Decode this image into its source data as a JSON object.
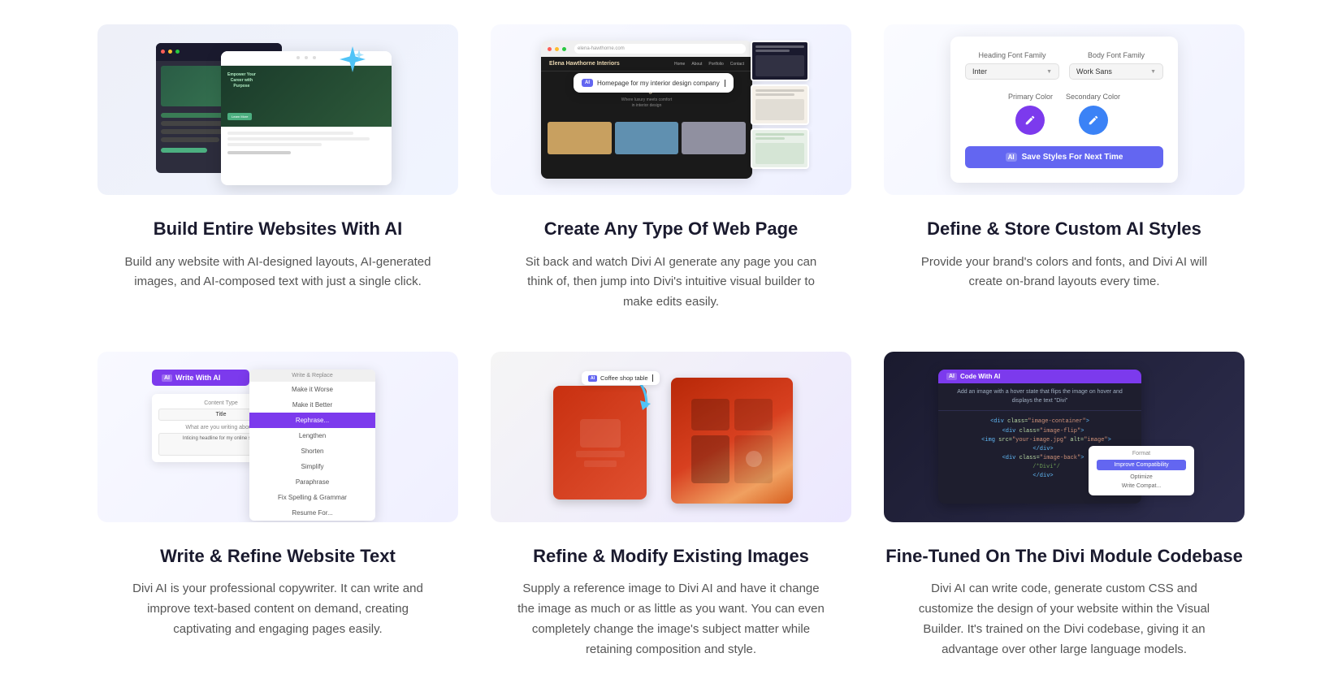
{
  "features": [
    {
      "id": "build-websites",
      "title": "Build Entire Websites With AI",
      "description": "Build any website with AI-designed layouts, AI-generated images, and AI-composed text with just a single click.",
      "image_alt": "AI website builder preview"
    },
    {
      "id": "create-pages",
      "title": "Create Any Type Of Web Page",
      "description": "Sit back and watch Divi AI generate any page you can think of, then jump into Divi's intuitive visual builder to make edits easily.",
      "image_alt": "Web page creation preview"
    },
    {
      "id": "define-styles",
      "title": "Define & Store Custom AI Styles",
      "description": "Provide your brand's colors and fonts, and Divi AI will create on-brand layouts every time.",
      "image_alt": "Custom AI styles panel"
    },
    {
      "id": "write-text",
      "title": "Write & Refine Website Text",
      "description": "Divi AI is your professional copywriter. It can write and improve text-based content on demand, creating captivating and engaging pages easily.",
      "image_alt": "Write with AI panel"
    },
    {
      "id": "refine-images",
      "title": "Refine & Modify Existing Images",
      "description": "Supply a reference image to Divi AI and have it change the image as much or as little as you want. You can even completely change the image's subject matter while retaining composition and style.",
      "image_alt": "Image refinement preview"
    },
    {
      "id": "fine-tuned-code",
      "title": "Fine-Tuned On The Divi Module Codebase",
      "description": "Divi AI can write code, generate custom CSS and customize the design of your website within the Visual Builder. It's trained on the Divi codebase, giving it an advantage over other large language models.",
      "image_alt": "Code editing with AI"
    }
  ],
  "ui": {
    "ai_badge": "AI",
    "heading_font_label": "Heading Font Family",
    "body_font_label": "Body Font Family",
    "heading_font_value": "Inter",
    "body_font_value": "Work Sans",
    "primary_color_label": "Primary Color",
    "secondary_color_label": "Secondary Color",
    "save_styles_btn": "Save Styles For Next Time",
    "write_ai_btn": "Write With AI",
    "ai_chat_prompt": "Homepage for my interior design company",
    "coffee_prompt": "Coffee shop table",
    "format_label": "Format",
    "improve_btn": "Improve Compatibility",
    "optimize_opt": "Optimize",
    "write_compat": "Write Compat...",
    "write_replace_header": "Write & Replace",
    "dropdown_items": [
      "Make it Worse",
      "Make it Better",
      "Rephrase...",
      "Lengthen",
      "Shorten",
      "Simplify",
      "Paraphrase",
      "Fix Spelling & Grammar",
      "Resume For..."
    ],
    "content_type_label": "Content Type",
    "title_value": "Title",
    "what_writing_label": "What are you writing about?",
    "inticing_value": "Inticing headline for my online store",
    "code_with_ai_header": "Code With AI",
    "code_description": "Add an image with a hover state that flips the image on hover and displays the text \"Divi\""
  }
}
